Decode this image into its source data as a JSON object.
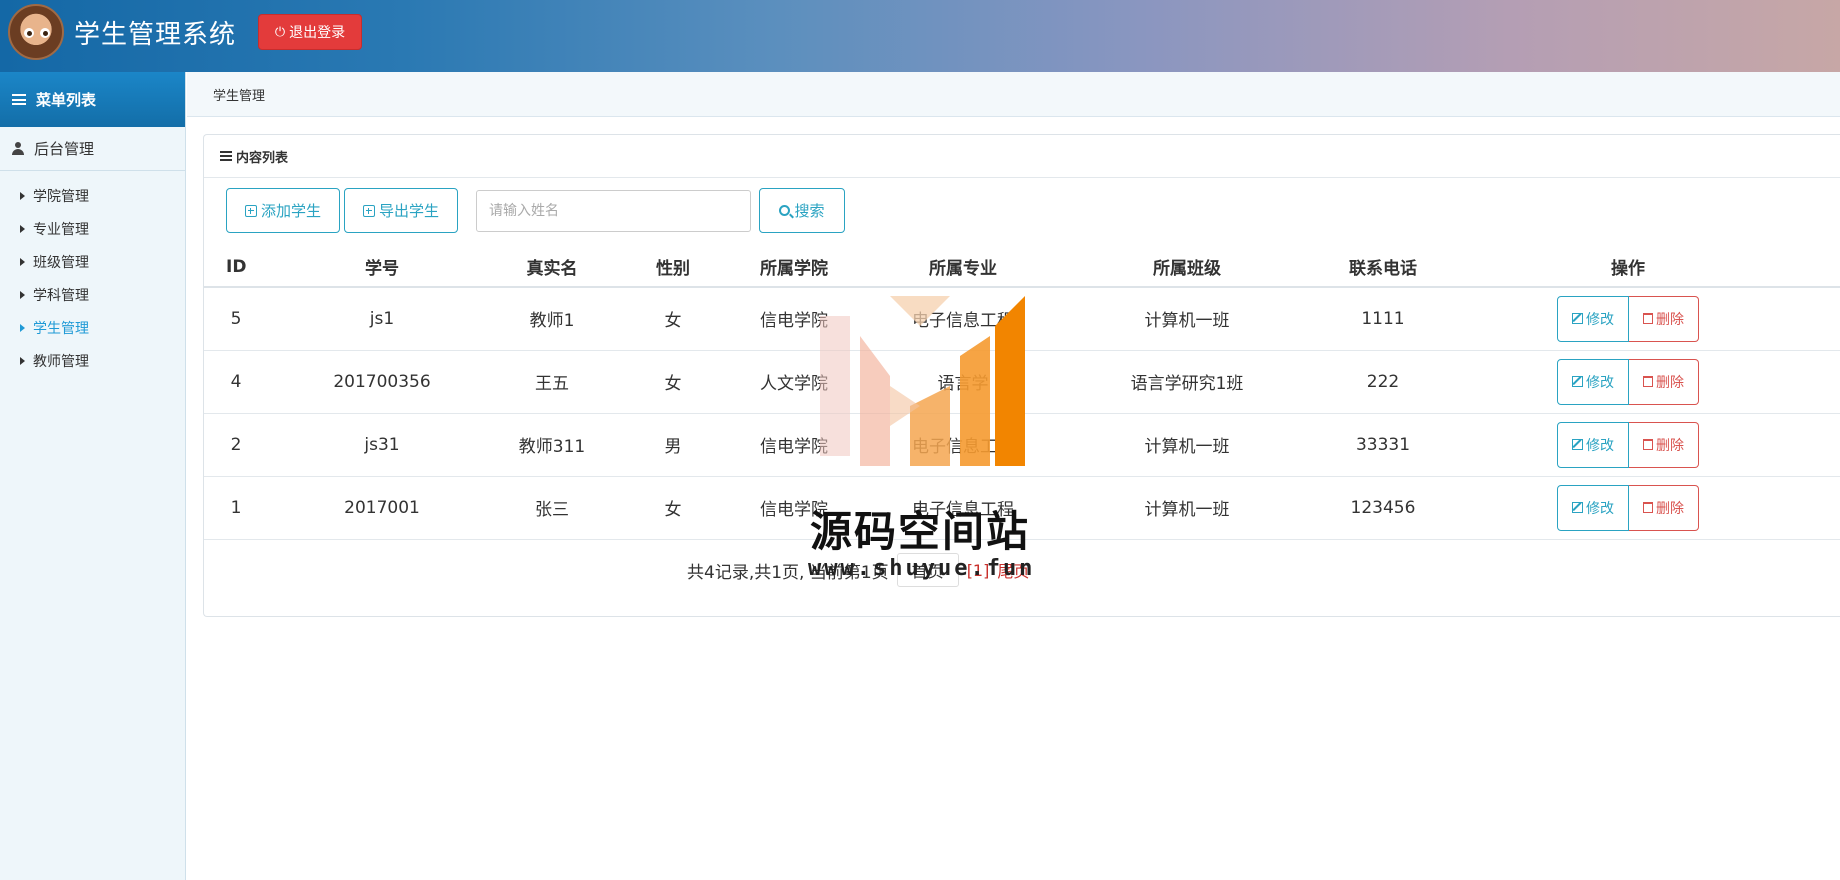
{
  "header": {
    "title": "学生管理系统",
    "logout_label": "退出登录"
  },
  "sidebar": {
    "heading": "菜单列表",
    "group": "后台管理",
    "items": [
      {
        "label": "学院管理"
      },
      {
        "label": "专业管理"
      },
      {
        "label": "班级管理"
      },
      {
        "label": "学科管理"
      },
      {
        "label": "学生管理"
      },
      {
        "label": "教师管理"
      }
    ],
    "active_index": 4
  },
  "breadcrumb": "学生管理",
  "panel": {
    "heading": "内容列表",
    "add_label": "添加学生",
    "export_label": "导出学生",
    "search_placeholder": "请输入姓名",
    "search_label": "搜索"
  },
  "table": {
    "columns": [
      "ID",
      "学号",
      "真实名",
      "性别",
      "所属学院",
      "所属专业",
      "所属班级",
      "联系电话",
      "操作"
    ],
    "rows": [
      {
        "id": "5",
        "no": "js1",
        "name": "教师1",
        "gender": "女",
        "college": "信电学院",
        "major": "电子信息工程",
        "class": "计算机一班",
        "phone": "1111"
      },
      {
        "id": "4",
        "no": "201700356",
        "name": "王五",
        "gender": "女",
        "college": "人文学院",
        "major": "语言学",
        "class": "语言学研究1班",
        "phone": "222"
      },
      {
        "id": "2",
        "no": "js31",
        "name": "教师311",
        "gender": "男",
        "college": "信电学院",
        "major": "电子信息工程",
        "class": "计算机一班",
        "phone": "33331"
      },
      {
        "id": "1",
        "no": "2017001",
        "name": "张三",
        "gender": "女",
        "college": "信电学院",
        "major": "电子信息工程",
        "class": "计算机一班",
        "phone": "123456"
      }
    ],
    "edit_label": "修改",
    "delete_label": "删除"
  },
  "pagination": {
    "summary": "共4记录,共1页, 当前第1页",
    "first_label": "首页",
    "current_page": "[1]",
    "last_label": "尾页"
  },
  "watermark": {
    "text": "源码空间站",
    "url": "www.shuyue.fun"
  },
  "colors": {
    "accent": "#2aa3c2",
    "danger": "#d9534f",
    "logout": "#e33b3b",
    "sidebar_header": "#1b86c8",
    "active_menu": "#1f9ad6"
  }
}
